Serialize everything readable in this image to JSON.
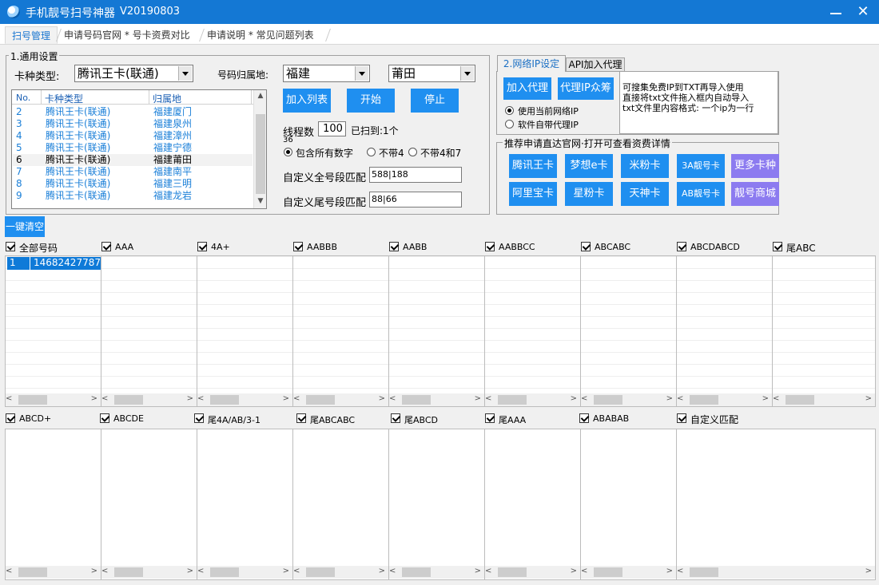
{
  "window": {
    "title": "手机靓号扫号神器",
    "version": "V20190803"
  },
  "tabs": [
    {
      "label": "扫号管理"
    },
    {
      "label": "申请号码官网 * 号卡资费对比"
    },
    {
      "label": "申请说明 * 常见问题列表"
    }
  ],
  "general": {
    "group_label": "1.通用设置",
    "card_type_label": "卡种类型:",
    "card_type_value": "腾讯王卡(联通)",
    "region_label": "号码归属地:",
    "province_value": "福建",
    "city_value": "莆田",
    "list_headers": [
      "No.",
      "卡种类型",
      "归属地"
    ],
    "list_rows": [
      {
        "no": "2",
        "type": "腾讯王卡(联通)",
        "region": "福建厦门"
      },
      {
        "no": "3",
        "type": "腾讯王卡(联通)",
        "region": "福建泉州"
      },
      {
        "no": "4",
        "type": "腾讯王卡(联通)",
        "region": "福建漳州"
      },
      {
        "no": "5",
        "type": "腾讯王卡(联通)",
        "region": "福建宁德"
      },
      {
        "no": "6",
        "type": "腾讯王卡(联通)",
        "region": "福建莆田"
      },
      {
        "no": "7",
        "type": "腾讯王卡(联通)",
        "region": "福建南平"
      },
      {
        "no": "8",
        "type": "腾讯王卡(联通)",
        "region": "福建三明"
      },
      {
        "no": "9",
        "type": "腾讯王卡(联通)",
        "region": "福建龙岩"
      }
    ],
    "selected_row": "6",
    "add_list_btn": "加入列表",
    "start_btn": "开始",
    "stop_btn": "停止",
    "thread_label": "线程数",
    "thread_value": "100",
    "scanned_text": "已扫到:1个",
    "thread_sub": "36",
    "radio_all": "包含所有数字",
    "radio_no4": "不带4",
    "radio_no47": "不带4和7",
    "full_match_label": "自定义全号段匹配",
    "full_match_value": "588|188",
    "tail_match_label": "自定义尾号段匹配",
    "tail_match_value": "88|66"
  },
  "network": {
    "tab_ip": "2.网络IP设定",
    "tab_api": "API加入代理",
    "add_proxy_btn": "加入代理",
    "crowd_btn": "代理IP众筹",
    "radio_current": "使用当前网络IP",
    "radio_builtin": "软件自带代理IP",
    "note_line1": "可搜集免费IP到TXT再导入使用",
    "note_line2": "直接将txt文件拖入框内自动导入",
    "note_line3": "txt文件里内容格式: 一个ip为一行"
  },
  "recommend": {
    "group_label": "推荐申请直达官网·打开可查看资费详情",
    "buttons": [
      {
        "label": "腾讯王卡"
      },
      {
        "label": "梦想e卡"
      },
      {
        "label": "米粉卡"
      },
      {
        "label": "3A靓号卡"
      },
      {
        "label": "更多卡种"
      },
      {
        "label": "阿里宝卡"
      },
      {
        "label": "星粉卡"
      },
      {
        "label": "天神卡"
      },
      {
        "label": "AB靓号卡"
      },
      {
        "label": "靓号商城"
      }
    ]
  },
  "clear_btn": "一键清空",
  "top_panels": [
    {
      "label": "全部号码"
    },
    {
      "label": "AAA"
    },
    {
      "label": "4A+"
    },
    {
      "label": "AABBB"
    },
    {
      "label": "AABB"
    },
    {
      "label": "AABBCC"
    },
    {
      "label": "ABCABC"
    },
    {
      "label": "ABCDABCD"
    },
    {
      "label": "尾ABC"
    }
  ],
  "found_number": {
    "index": "1",
    "number": "14682427787"
  },
  "bottom_panels": [
    {
      "label": "ABCD+"
    },
    {
      "label": "ABCDE"
    },
    {
      "label": "尾4A/AB/3-1"
    },
    {
      "label": "尾ABCABC"
    },
    {
      "label": "尾ABCD"
    },
    {
      "label": "尾AAA"
    },
    {
      "label": "ABABAB"
    },
    {
      "label": "自定义匹配"
    }
  ],
  "colors": {
    "titlebar": "#1478d4",
    "button_blue": "#1f8ff0",
    "button_purple": "#8c7bf0",
    "list_text": "#1a7fd8"
  }
}
